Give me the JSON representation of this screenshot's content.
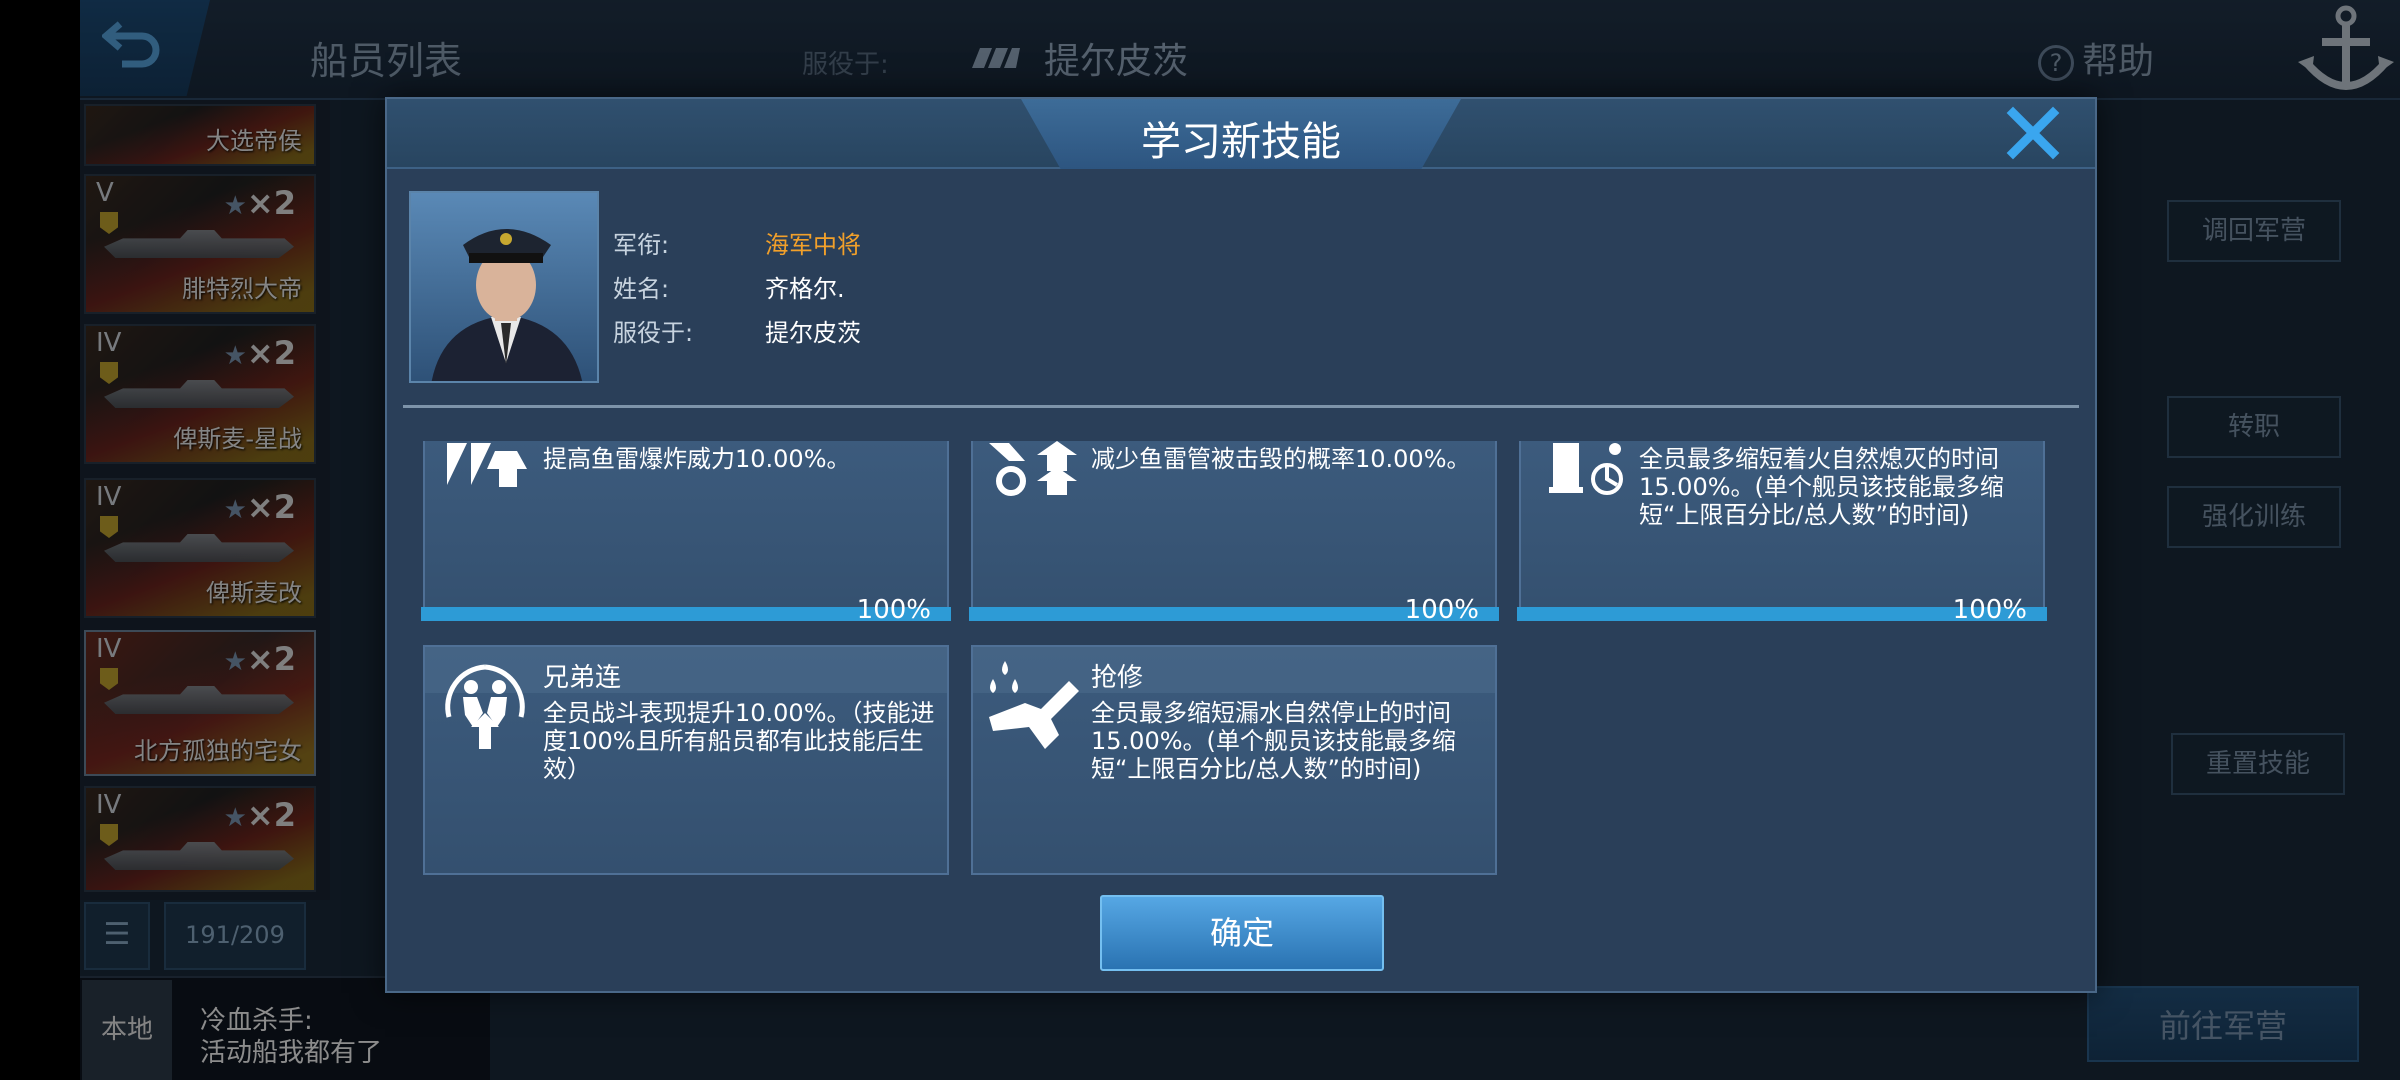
{
  "topbar": {
    "list_title": "船员列表",
    "serve_label": "服役于:",
    "serve_ship": "提尔皮茨",
    "help_label": "帮助"
  },
  "crew_list": [
    {
      "tier": "",
      "stars": "",
      "name": "大选帝侯"
    },
    {
      "tier": "V",
      "stars": "×2",
      "name": "腓特烈大帝"
    },
    {
      "tier": "IV",
      "stars": "×2",
      "name": "俾斯麦-星战"
    },
    {
      "tier": "IV",
      "stars": "×2",
      "name": "俾斯麦改"
    },
    {
      "tier": "IV",
      "stars": "×2",
      "name": "北方孤独的宅女"
    },
    {
      "tier": "IV",
      "stars": "×2",
      "name": ""
    }
  ],
  "list_footer": {
    "count": "191/209",
    "menu_icon": "list-icon"
  },
  "chat": {
    "tab": "本地",
    "line1": "冷血杀手:",
    "line2": "活动船我都有了"
  },
  "background_buttons": {
    "recall": "调回军营",
    "transfer": "转职",
    "training": "强化训练",
    "reset": "重置技能",
    "go_barracks": "前往军营"
  },
  "modal": {
    "title": "学习新技能",
    "info": {
      "rank_label": "军衔:",
      "rank_value": "海军中将",
      "name_label": "姓名:",
      "name_value": "齐格尔.",
      "serve_label": "服役于:",
      "serve_value": "提尔皮茨"
    },
    "skills_top": [
      {
        "desc": "提高鱼雷爆炸威力10.00%。",
        "progress_text": "100%",
        "progress": 1.0,
        "icon": "torpedo-power-icon"
      },
      {
        "desc": "减少鱼雷管被击毁的概率10.00%。",
        "progress_text": "100%",
        "progress": 1.0,
        "icon": "torpedo-repair-icon"
      },
      {
        "desc": "全员最多缩短着火自然熄灭的时间15.00%。(单个舰员该技能最多缩短“上限百分比/总人数”的时间)",
        "progress_text": "100%",
        "progress": 1.0,
        "icon": "fire-extinguish-icon"
      }
    ],
    "skills_bottom": [
      {
        "name": "兄弟连",
        "desc": "全员战斗表现提升10.00%。（技能进度100%且所有船员都有此技能后生效）",
        "icon": "brotherhood-icon"
      },
      {
        "name": "抢修",
        "desc": "全员最多缩短漏水自然停止的时间15.00%。(单个舰员该技能最多缩短“上限百分比/总人数”的时间)",
        "icon": "repair-wrench-icon"
      }
    ],
    "confirm_label": "确定"
  }
}
